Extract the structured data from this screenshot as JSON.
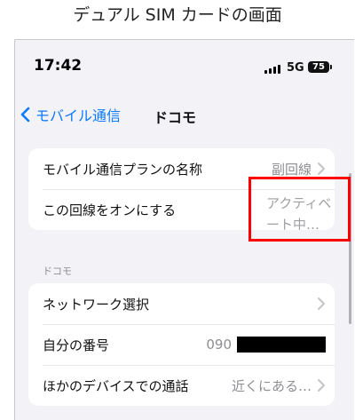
{
  "caption": "デュアル SIM カードの画面",
  "status_bar": {
    "time": "17:42",
    "network": "5G",
    "battery": "75"
  },
  "nav": {
    "back_label": "モバイル通信",
    "title": "ドコモ"
  },
  "group1": {
    "plan_label": "モバイル通信プランの名称",
    "plan_value": "副回線",
    "line_label": "この回線をオンにする",
    "line_value": "アクティベート中…"
  },
  "section_header": "ドコモ",
  "group2": {
    "network_select_label": "ネットワーク選択",
    "my_number_label": "自分の番号",
    "my_number_value": "090",
    "other_devices_label": "ほかのデバイスでの通話",
    "other_devices_value": "近くにある…"
  },
  "colors": {
    "accent": "#0a7aff",
    "highlight": "#ff0000",
    "background": "#f2f2f7"
  },
  "icons": [
    "chevron-left-icon",
    "chevron-right-icon",
    "signal-icon",
    "battery-icon"
  ]
}
